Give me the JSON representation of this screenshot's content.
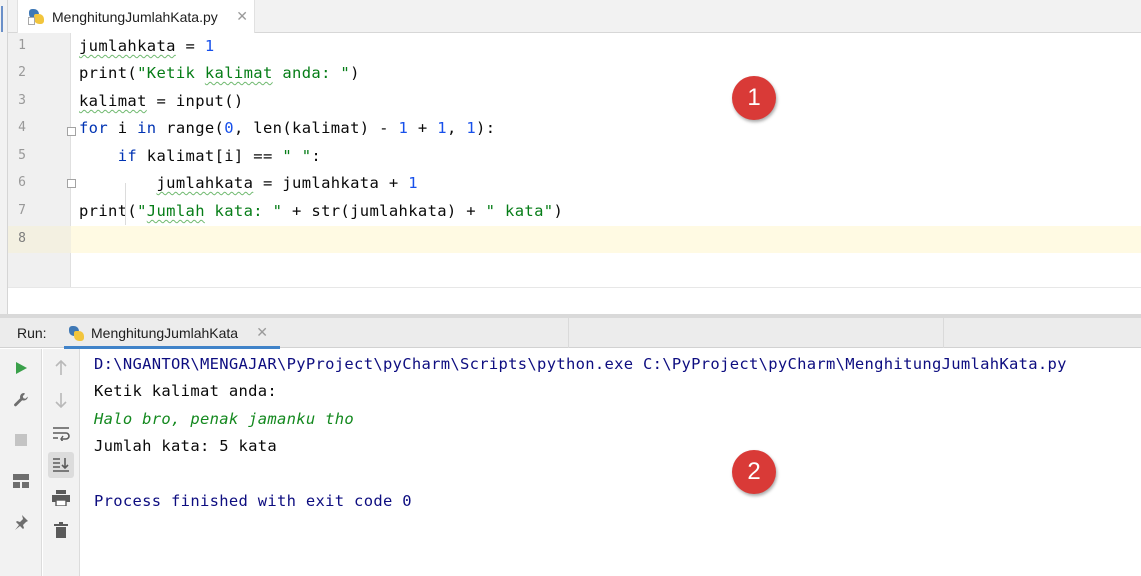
{
  "editor": {
    "tab_label": "MenghitungJumlahKata.py",
    "tab_close": "✕",
    "lines": [
      {
        "num": "1"
      },
      {
        "num": "2"
      },
      {
        "num": "3"
      },
      {
        "num": "4"
      },
      {
        "num": "5"
      },
      {
        "num": "6"
      },
      {
        "num": "7"
      },
      {
        "num": "8"
      }
    ],
    "current_line": "8"
  },
  "run": {
    "title": "Run:",
    "tab_label": "MenghitungJumlahKata",
    "tab_close": "✕",
    "console": {
      "command": "D:\\NGANTOR\\MENGAJAR\\PyProject\\pyCharm\\Scripts\\python.exe C:\\PyProject\\pyCharm\\MenghitungJumlahKata.py",
      "prompt": "Ketik kalimat anda:",
      "user_input": "Halo bro, penak jamanku tho",
      "result": "Jumlah kata: 5 kata",
      "exit": "Process finished with exit code 0"
    },
    "toolbar_icons": [
      "run-icon",
      "wrench-icon",
      "stop-icon",
      "layout-icon",
      "pin-icon",
      "up-arrow-icon",
      "down-arrow-icon",
      "soft-wrap-icon",
      "scroll-to-end-icon",
      "print-icon",
      "trash-icon"
    ]
  },
  "annotations": {
    "badge_1": "1",
    "badge_2": "2"
  },
  "colors": {
    "keyword": "#0033b3",
    "number": "#1750eb",
    "string": "#067d17",
    "console_path": "#0d0d80",
    "console_input": "#14891f",
    "badge": "#d93a37",
    "current_line": "#fffae3"
  }
}
